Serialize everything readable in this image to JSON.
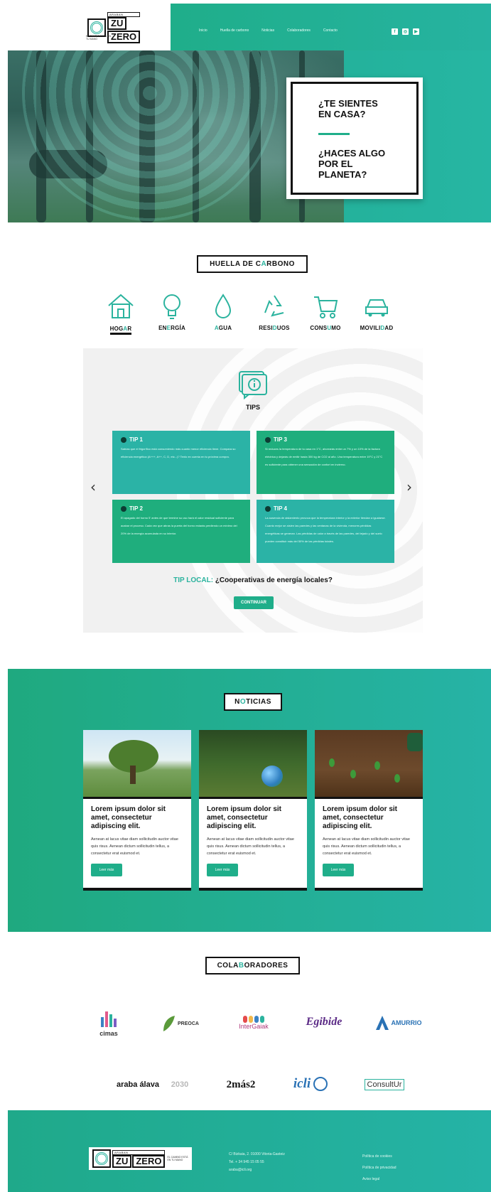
{
  "header": {
    "logo": {
      "small": "ARABAN",
      "big1": "ZU",
      "big2": "ZERO",
      "tag": "EL CAMBIO ESTÁ EN TU MANO"
    },
    "nav": [
      "Inicio",
      "Huella de carbono",
      "Noticias",
      "Colaboradores",
      "Contacto"
    ],
    "social": [
      "f",
      "◎",
      "▶"
    ]
  },
  "hero": {
    "q1_line1": "¿TE SIENTES",
    "q1_line2": "EN CASA?",
    "q2_line1": "¿HACES ALGO",
    "q2_line2": "POR EL",
    "q2_line3": "PLANETA?"
  },
  "huella": {
    "title_a": "HUELLA DE C",
    "title_b": "A",
    "title_c": "RBONO",
    "categories": [
      {
        "a": "HOG",
        "b": "A",
        "c": "R",
        "icon": "house-icon"
      },
      {
        "a": "EN",
        "b": "E",
        "c": "RGÍA",
        "icon": "lightbulb-icon"
      },
      {
        "a": "",
        "b": "A",
        "c": "GUA",
        "icon": "water-drop-icon"
      },
      {
        "a": "RESI",
        "b": "D",
        "c": "UOS",
        "icon": "recycle-icon"
      },
      {
        "a": "CONS",
        "b": "U",
        "c": "MO",
        "icon": "cart-icon"
      },
      {
        "a": "MOVILI",
        "b": "D",
        "c": "AD",
        "icon": "car-icon"
      }
    ]
  },
  "tips": {
    "title": "TIPS",
    "items": [
      {
        "title": "TIP 1",
        "text": "Sabías que el frigorífico está consumiendo más cuanto menor eficiencia tiene. Compara su eficiencia energética (A+++, A++, C, D, etc...)? Tenlo en cuenta en tu próxima compra."
      },
      {
        "title": "TIP 3",
        "text": "Si reduces la temperatura de tu casa en 1°C, ahorrarás entre un 7% y un 10% de la factura eléctrica y dejarás de emitir hasta 300 kg de CO2 al año. Una temperatura entre 19°C y 21°C es suficiente para obtener una sensación de confort en invierno."
      },
      {
        "title": "TIP 2",
        "text": "El apagado del horno 5' antes de que termine su uso hará el calor residual suficiente para acabar el proceso. Cada vez que abras la puerta del horno estarás perdiendo un mínimo del 20% de la energía acumulada en su interior."
      },
      {
        "title": "TIP 4",
        "text": "La ausencia de aislamiento provoca que la temperatura interior y la exterior tiendan a igualarse. Cuanto mejor se aíslen las paredes y las ventanas de la vivienda, menores pérdidas energéticas se generan. Las pérdidas de calor a través de las paredes, del tejado y del suelo pueden constituir más del 50% de las pérdidas totales."
      }
    ],
    "local_key": "TIP LOCAL:",
    "local_text": "¿Cooperativas de energía locales?",
    "continue": "CONTINUAR",
    "prev": "‹",
    "next": "›"
  },
  "news": {
    "title_a": "N",
    "title_b": "O",
    "title_c": "TICIAS",
    "cards": [
      {
        "title": "Lorem ipsum dolor sit amet, consectetur adipiscing elit.",
        "text": "Aenean at lacus vitae diam sollicitudin auctor vitae quis risus. Aenean dictum sollicitudin tellus, a consectetur erat euismod et.",
        "button": "Leer más"
      },
      {
        "title": "Lorem ipsum dolor sit amet, consectetur adipiscing elit.",
        "text": "Aenean at lacus vitae diam sollicitudin auctor vitae quis risus. Aenean dictum sollicitudin tellus, a consectetur erat euismod et.",
        "button": "Leer más"
      },
      {
        "title": "Lorem ipsum dolor sit amet, consectetur adipiscing elit.",
        "text": "Aenean at lacus vitae diam sollicitudin auctor vitae quis risus. Aenean dictum sollicitudin tellus, a consectetur erat euismod et.",
        "button": "Leer más"
      }
    ]
  },
  "colaboradores": {
    "title_a": "COLA",
    "title_b": "B",
    "title_c": "ORADORES",
    "logos": [
      "cimas",
      "PREOCA",
      "InterGaiak",
      "Egibide",
      "AMURRIO",
      "araba álava",
      "2030",
      "2más2",
      "icli",
      "ConsultUr"
    ]
  },
  "footer": {
    "address": [
      "C/ Bizkaia, 2. 01000 Vitoria-Gasteiz",
      "Tel. + 34 945 15 05 55",
      "araba@icli.org"
    ],
    "links": [
      "Política de cookies",
      "Política de privacidad",
      "Aviso legal"
    ]
  },
  "colors": {
    "brand": "#1fae8a",
    "accent": "#2bb39e"
  }
}
